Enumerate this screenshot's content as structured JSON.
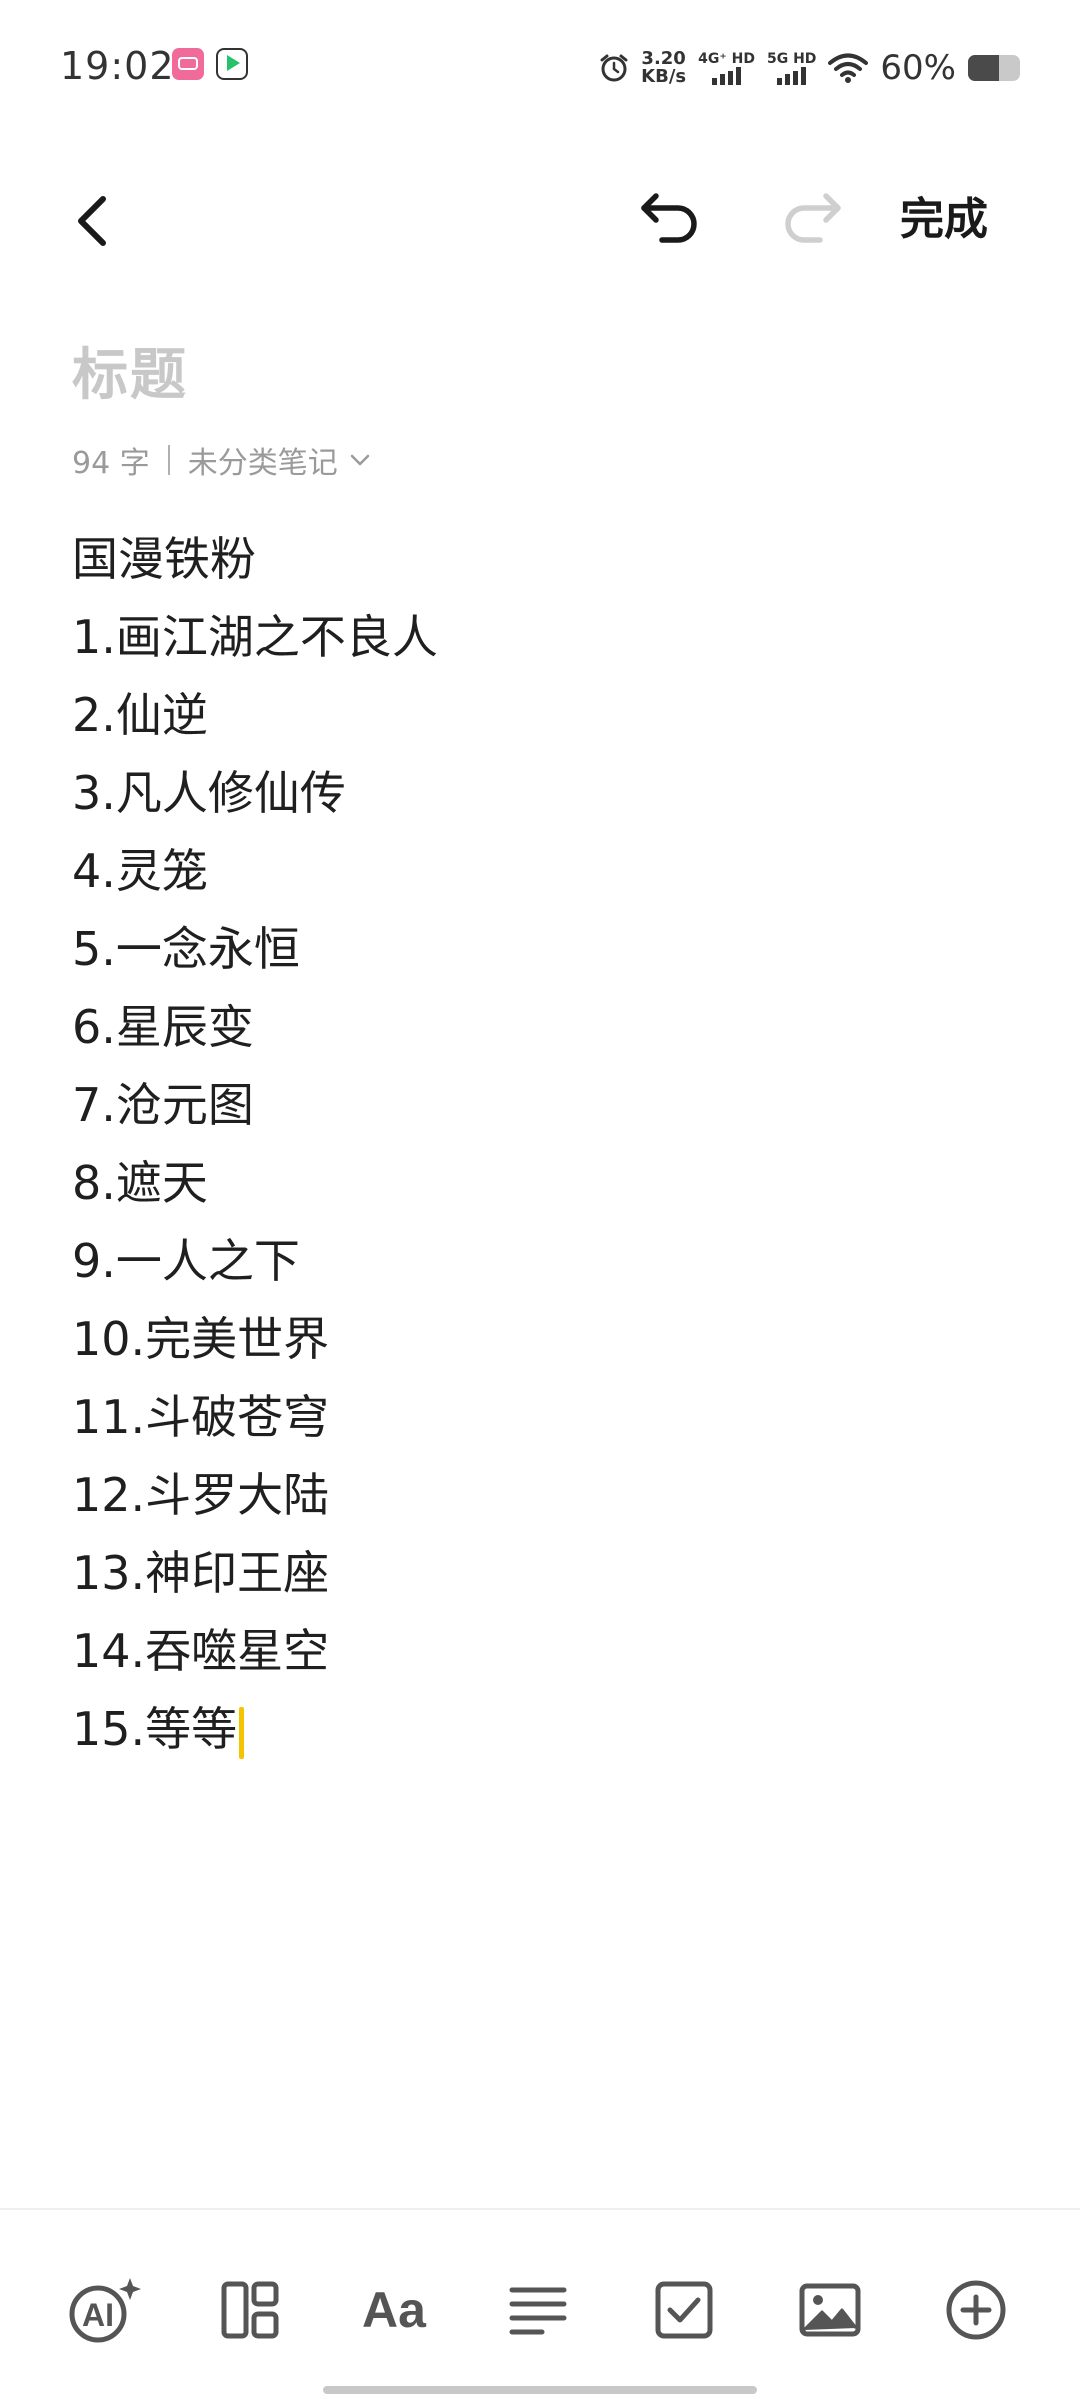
{
  "status_bar": {
    "time": "19:02",
    "net_speed_value": "3.20",
    "net_speed_unit": "KB/s",
    "sim1_label": "4G⁺ HD",
    "sim2_label": "5G HD",
    "battery_text": "60%",
    "battery_level": 0.6,
    "icons": [
      "bilibili-app-icon",
      "video-app-icon",
      "alarm-icon",
      "signal-icon",
      "wifi-icon",
      "battery-icon"
    ]
  },
  "toolbar": {
    "back_icon": "chevron-left-icon",
    "undo_icon": "undo-icon",
    "redo_icon": "redo-icon",
    "redo_enabled": false,
    "done_label": "完成"
  },
  "note": {
    "title_placeholder": "标题",
    "word_count": "94 字",
    "category": "未分类笔记",
    "lines": [
      "国漫铁粉",
      "1.画江湖之不良人",
      "2.仙逆",
      "3.凡人修仙传",
      "4.灵笼",
      "5.一念永恒",
      "6.星辰变",
      "7.沧元图",
      "8.遮天",
      "9.一人之下",
      "10.完美世界",
      "11.斗破苍穹",
      "12.斗罗大陆",
      "13.神印王座",
      "14.吞噬星空",
      "15.等等"
    ]
  },
  "bottom_toolbar": {
    "ai_label": "AI",
    "text_style_label": "Aa",
    "tools": [
      "ai-assist-icon",
      "template-icon",
      "text-style-icon",
      "align-icon",
      "checklist-icon",
      "image-icon",
      "add-icon"
    ]
  },
  "colors": {
    "cursor": "#f5c400",
    "title_placeholder": "#c8c8c8",
    "text": "#1f1f1f",
    "muted": "#9a9a9a"
  }
}
